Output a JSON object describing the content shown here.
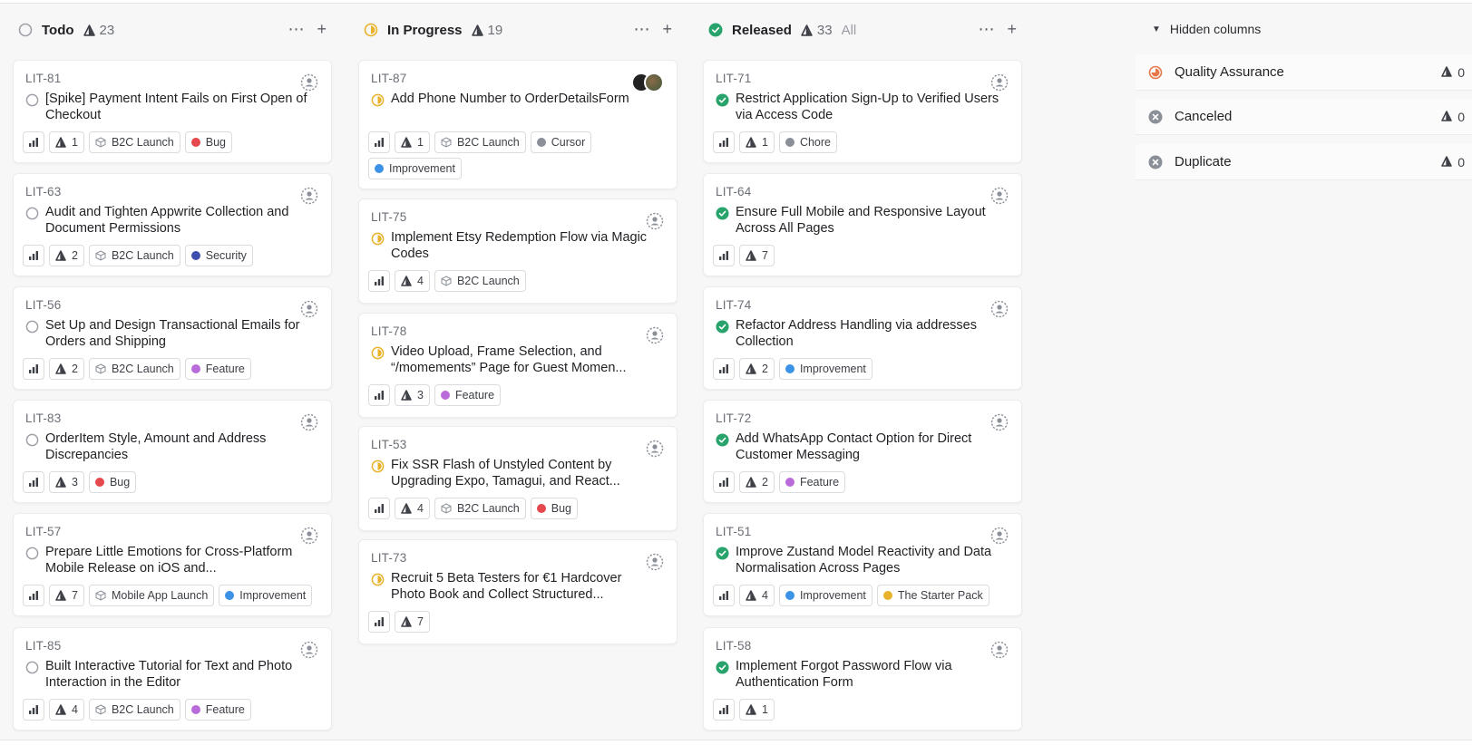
{
  "colors": {
    "todo": "#a1a1a8",
    "in_progress": "#e8b22b",
    "released": "#27a36b",
    "qa": "#e8784a",
    "canceled": "#8a8f98"
  },
  "columns": [
    {
      "title": "Todo",
      "count": "23",
      "all_label": "",
      "status": "todo",
      "cards": [
        {
          "id": "LIT-81",
          "title": "[Spike] Payment Intent Fails on First Open of Checkout",
          "estimate": "1",
          "labels": [
            {
              "type": "project",
              "text": "B2C Launch"
            },
            {
              "type": "dot",
              "text": "Bug",
              "color": "#e5484d"
            }
          ]
        },
        {
          "id": "LIT-63",
          "title": "Audit and Tighten Appwrite Collection and Document Permissions",
          "estimate": "2",
          "labels": [
            {
              "type": "project",
              "text": "B2C Launch"
            },
            {
              "type": "dot",
              "text": "Security",
              "color": "#3e4fb0"
            }
          ]
        },
        {
          "id": "LIT-56",
          "title": "Set Up and Design Transactional Emails for Orders and Shipping",
          "estimate": "2",
          "labels": [
            {
              "type": "project",
              "text": "B2C Launch"
            },
            {
              "type": "dot",
              "text": "Feature",
              "color": "#bb6bd9"
            }
          ]
        },
        {
          "id": "LIT-83",
          "title": "OrderItem Style, Amount and Address Discrepancies",
          "estimate": "3",
          "labels": [
            {
              "type": "dot",
              "text": "Bug",
              "color": "#e5484d"
            }
          ]
        },
        {
          "id": "LIT-57",
          "title": "Prepare Little Emotions for Cross-Platform Mobile Release on iOS and...",
          "estimate": "7",
          "labels": [
            {
              "type": "project",
              "text": "Mobile App Launch"
            },
            {
              "type": "dot",
              "text": "Improvement",
              "color": "#3b92e6"
            }
          ]
        },
        {
          "id": "LIT-85",
          "title": "Built Interactive Tutorial for Text and Photo Interaction in the Editor",
          "estimate": "4",
          "labels": [
            {
              "type": "project",
              "text": "B2C Launch"
            },
            {
              "type": "dot",
              "text": "Feature",
              "color": "#bb6bd9"
            }
          ]
        }
      ]
    },
    {
      "title": "In Progress",
      "count": "19",
      "all_label": "",
      "status": "in_progress",
      "cards": [
        {
          "id": "LIT-87",
          "title": "Add Phone Number to OrderDetailsForm",
          "estimate": "1",
          "avatars": true,
          "labels": [
            {
              "type": "project",
              "text": "B2C Launch"
            },
            {
              "type": "dot",
              "text": "Cursor",
              "color": "#8a8f98"
            },
            {
              "type": "dot",
              "text": "Improvement",
              "color": "#3b92e6"
            }
          ]
        },
        {
          "id": "LIT-75",
          "title": "Implement Etsy Redemption Flow via Magic Codes",
          "estimate": "4",
          "labels": [
            {
              "type": "project",
              "text": "B2C Launch"
            }
          ]
        },
        {
          "id": "LIT-78",
          "title": "Video Upload, Frame Selection, and “/momements” Page for Guest Momen...",
          "estimate": "3",
          "labels": [
            {
              "type": "dot",
              "text": "Feature",
              "color": "#bb6bd9"
            }
          ]
        },
        {
          "id": "LIT-53",
          "title": "Fix SSR Flash of Unstyled Content by Upgrading Expo, Tamagui, and React...",
          "estimate": "4",
          "labels": [
            {
              "type": "project",
              "text": "B2C Launch"
            },
            {
              "type": "dot",
              "text": "Bug",
              "color": "#e5484d"
            }
          ]
        },
        {
          "id": "LIT-73",
          "title": "Recruit 5 Beta Testers for €1 Hardcover Photo Book and Collect Structured...",
          "estimate": "7",
          "labels": []
        }
      ]
    },
    {
      "title": "Released",
      "count": "33",
      "all_label": "All",
      "status": "released",
      "cards": [
        {
          "id": "LIT-71",
          "title": "Restrict Application Sign-Up to Verified Users via Access Code",
          "estimate": "1",
          "labels": [
            {
              "type": "dot",
              "text": "Chore",
              "color": "#8a8f98"
            }
          ]
        },
        {
          "id": "LIT-64",
          "title": "Ensure Full Mobile and Responsive Layout Across All Pages",
          "estimate": "7",
          "labels": []
        },
        {
          "id": "LIT-74",
          "title": "Refactor Address Handling via addresses Collection",
          "estimate": "2",
          "labels": [
            {
              "type": "dot",
              "text": "Improvement",
              "color": "#3b92e6"
            }
          ]
        },
        {
          "id": "LIT-72",
          "title": "Add WhatsApp Contact Option for Direct Customer Messaging",
          "estimate": "2",
          "labels": [
            {
              "type": "dot",
              "text": "Feature",
              "color": "#bb6bd9"
            }
          ]
        },
        {
          "id": "LIT-51",
          "title": "Improve Zustand Model Reactivity and Data Normalisation Across Pages",
          "estimate": "4",
          "labels": [
            {
              "type": "dot",
              "text": "Improvement",
              "color": "#3b92e6"
            },
            {
              "type": "dot",
              "text": "The Starter Pack",
              "color": "#e8b22b"
            }
          ]
        },
        {
          "id": "LIT-58",
          "title": "Implement Forgot Password Flow via Authentication Form",
          "estimate": "1",
          "labels": []
        }
      ]
    }
  ],
  "hidden": {
    "title": "Hidden columns",
    "items": [
      {
        "name": "Quality Assurance",
        "count": "0",
        "status": "qa"
      },
      {
        "name": "Canceled",
        "count": "0",
        "status": "canceled"
      },
      {
        "name": "Duplicate",
        "count": "0",
        "status": "canceled"
      }
    ]
  }
}
